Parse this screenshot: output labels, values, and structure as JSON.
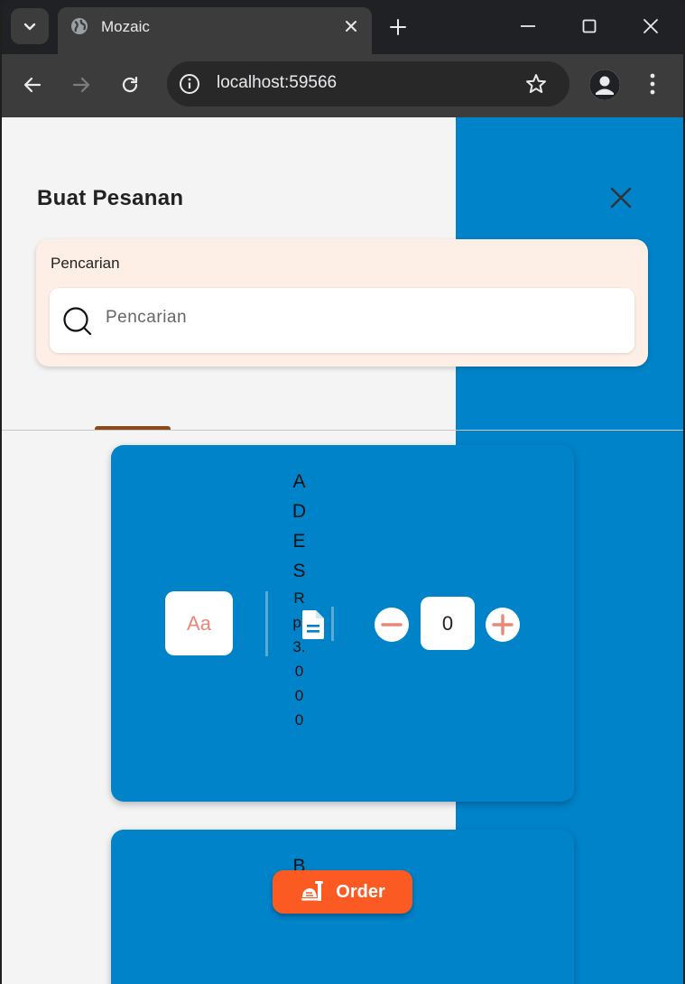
{
  "browser": {
    "tab_title": "Mozaic",
    "url": "localhost:59566"
  },
  "page": {
    "title": "Buat Pesanan",
    "search": {
      "label": "Pencarian",
      "placeholder": "Pencarian"
    }
  },
  "products": [
    {
      "thumb_text": "Aa",
      "name": "ADES",
      "price": "Rp.3.000",
      "quantity": "0"
    },
    {
      "name": "Bra"
    }
  ],
  "order_button": {
    "label": "Order"
  },
  "colors": {
    "accent_blue": "#0083c9",
    "order_orange": "#fb5a22",
    "search_card_bg": "#fdeee6",
    "icon_salmon": "#e8887a"
  }
}
